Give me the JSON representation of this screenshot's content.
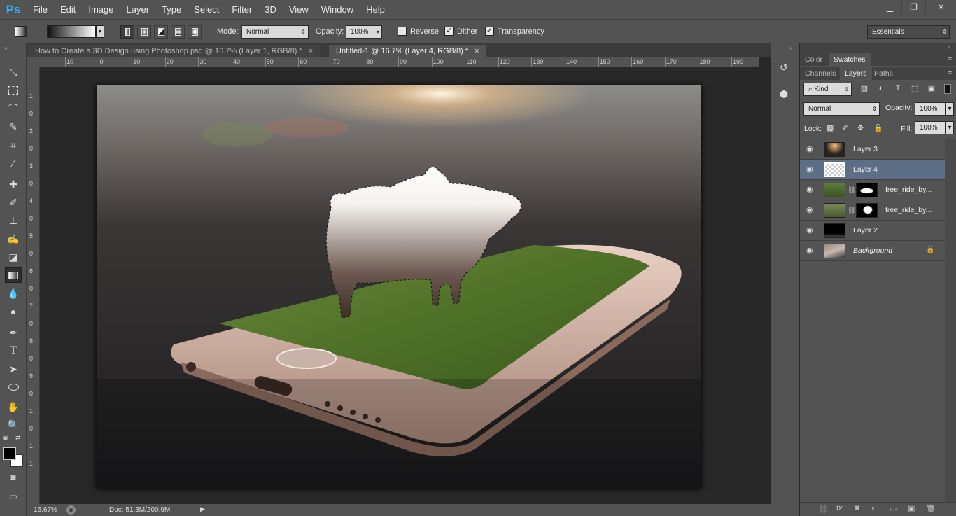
{
  "app": {
    "logo": "Ps"
  },
  "menu": [
    "File",
    "Edit",
    "Image",
    "Layer",
    "Type",
    "Select",
    "Filter",
    "3D",
    "View",
    "Window",
    "Help"
  ],
  "window_buttons": [
    "minimize-icon",
    "restore-icon",
    "close-icon"
  ],
  "options": {
    "mode_label": "Mode:",
    "mode_value": "Normal",
    "opacity_label": "Opacity:",
    "opacity_value": "100%",
    "reverse_label": "Reverse",
    "reverse_checked": false,
    "dither_label": "Dither",
    "dither_checked": true,
    "transparency_label": "Transparency",
    "transparency_checked": true,
    "workspace": "Essentials"
  },
  "tabs": [
    {
      "label": "How to Create a 3D Design using Photoshop.psd @ 16.7% (Layer 1, RGB/8) *",
      "close": "×",
      "active": false
    },
    {
      "label": "Untitled-1 @ 16.7% (Layer 4, RGB/8) *",
      "close": "×",
      "active": true
    }
  ],
  "ruler_h": [
    "10",
    "0",
    "10",
    "20",
    "30",
    "40",
    "50",
    "60",
    "70",
    "80",
    "90",
    "100",
    "110",
    "120",
    "130",
    "140",
    "150",
    "160",
    "170",
    "180",
    "190"
  ],
  "ruler_v": [
    "1",
    "0",
    "2",
    "0",
    "3",
    "0",
    "4",
    "0",
    "5",
    "0",
    "6",
    "0",
    "7",
    "0",
    "8",
    "0",
    "9",
    "0",
    "1",
    "0",
    "1",
    "1"
  ],
  "status": {
    "zoom": "16.67%",
    "doc": "Doc: 51.3M/200.9M"
  },
  "panels": {
    "top_tabs": [
      "Color",
      "Swatches"
    ],
    "layer_tabs": [
      "Channels",
      "Layers",
      "Paths"
    ],
    "kind_label": "Kind",
    "blend_mode": "Normal",
    "opacity_label": "Opacity:",
    "opacity_value": "100%",
    "lock_label": "Lock:",
    "fill_label": "Fill:",
    "fill_value": "100%"
  },
  "layers": [
    {
      "name": "Layer 3",
      "selected": false,
      "italic": false
    },
    {
      "name": "Layer 4",
      "selected": true,
      "italic": false
    },
    {
      "name": "free_ride_by...",
      "selected": false,
      "italic": false
    },
    {
      "name": "free_ride_by...",
      "selected": false,
      "italic": false
    },
    {
      "name": "Layer 2",
      "selected": false,
      "italic": false
    },
    {
      "name": "Background",
      "selected": false,
      "italic": true
    }
  ],
  "colors": {
    "ui": "#535353",
    "dark": "#282828",
    "selected_layer": "#5d6f86",
    "ps_blue": "#3fa9f5"
  }
}
